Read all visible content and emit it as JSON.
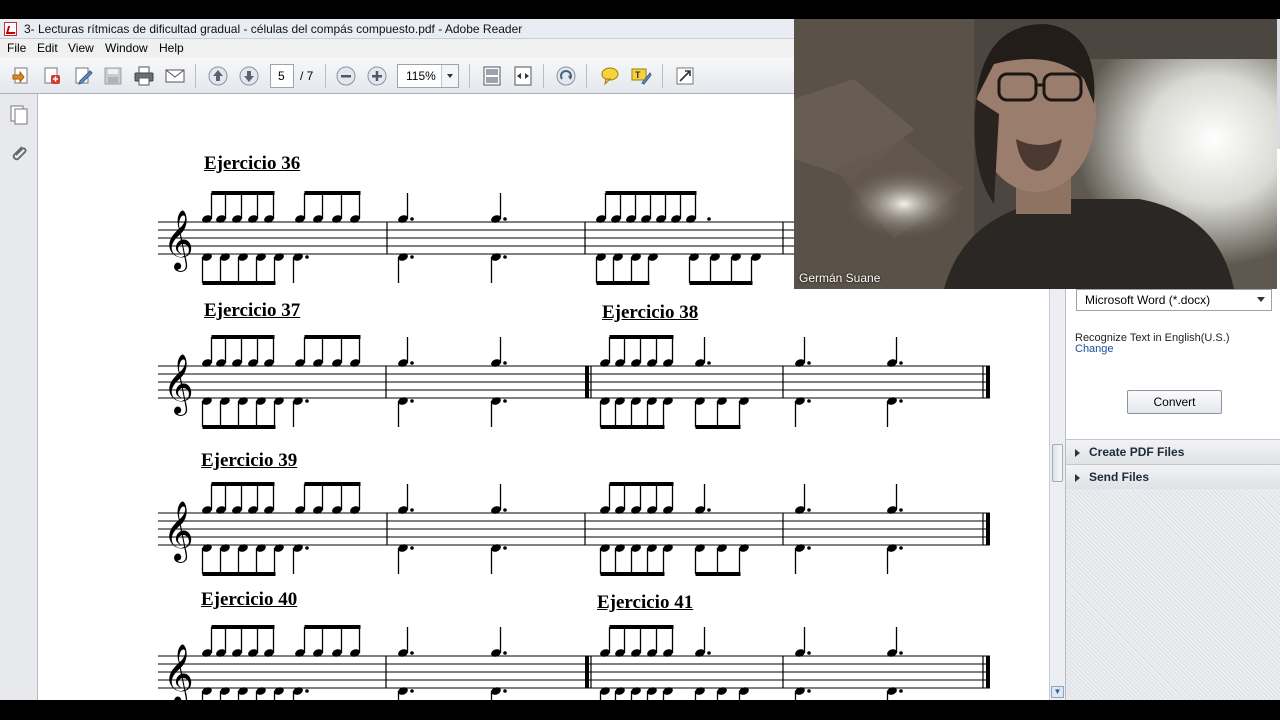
{
  "window": {
    "title": "3- Lecturas rítmicas de dificultad gradual - células del compás compuesto.pdf - Adobe Reader"
  },
  "menu": [
    "File",
    "Edit",
    "View",
    "Window",
    "Help"
  ],
  "toolbar": {
    "page_current": "5",
    "page_total": "/ 7",
    "zoom": "115%"
  },
  "document": {
    "exercises": [
      {
        "title": "Ejercicio 36"
      },
      {
        "title": "Ejercicio 37"
      },
      {
        "title": "Ejercicio 38"
      },
      {
        "title": "Ejercicio 39"
      },
      {
        "title": "Ejercicio 40"
      },
      {
        "title": "Ejercicio 41"
      }
    ]
  },
  "right_pane": {
    "convert_format": "Microsoft Word (*.docx)",
    "recognize_text": "Recognize Text in English(U.S.)",
    "change_link": "Change",
    "convert_button": "Convert",
    "sections": [
      "Create PDF Files",
      "Send Files"
    ]
  },
  "webcam": {
    "participant_name": "Germán Suane"
  }
}
